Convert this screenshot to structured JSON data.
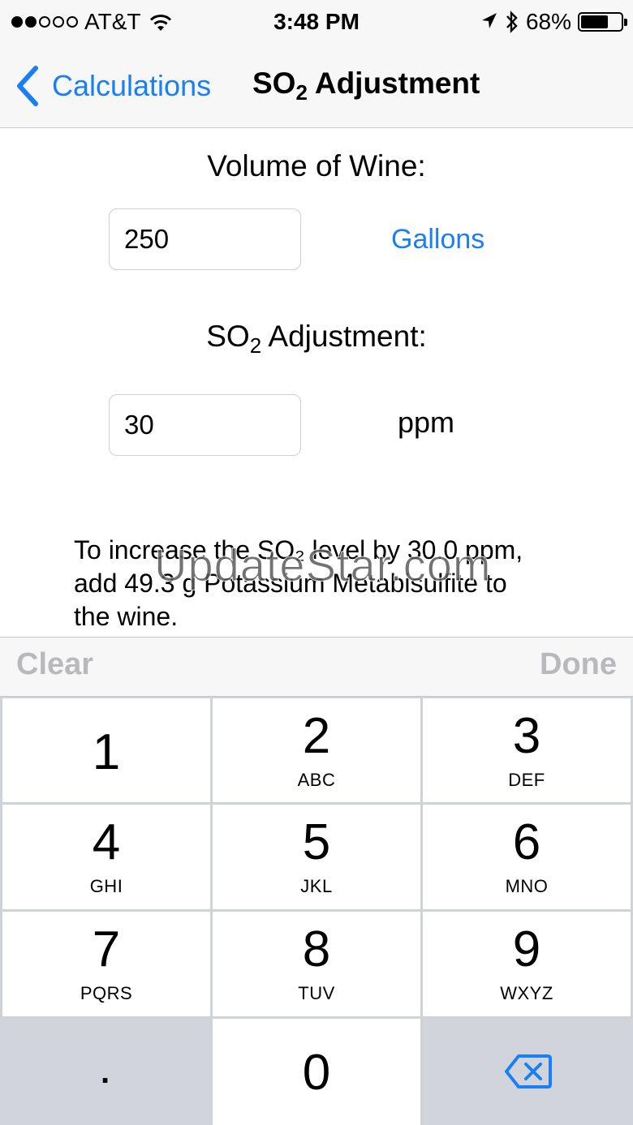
{
  "status_bar": {
    "carrier": "AT&T",
    "signal_bars_filled": 2,
    "signal_bars_total": 5,
    "time": "3:48 PM",
    "battery_percent": "68%",
    "battery_level": 0.68,
    "icons": [
      "wifi-icon",
      "location-icon",
      "bluetooth-icon",
      "battery-icon"
    ]
  },
  "nav": {
    "back_label": "Calculations",
    "title_prefix": "SO",
    "title_subscript": "2",
    "title_suffix": " Adjustment"
  },
  "form": {
    "volume_label": "Volume of Wine:",
    "volume_value": "250",
    "volume_unit": "Gallons",
    "so2_label_prefix": "SO",
    "so2_label_subscript": "2",
    "so2_label_suffix": " Adjustment:",
    "so2_value": "30",
    "so2_unit": "ppm"
  },
  "result_text": "To increase the SO₂ level by 30.0 ppm, add 49.3 g Potassium Metabisulfite to the wine.",
  "watermark": "UpdateStar.com",
  "toolbar": {
    "clear_label": "Clear",
    "done_label": "Done"
  },
  "keypad": {
    "keys": [
      {
        "digit": "1",
        "letters": ""
      },
      {
        "digit": "2",
        "letters": "ABC"
      },
      {
        "digit": "3",
        "letters": "DEF"
      },
      {
        "digit": "4",
        "letters": "GHI"
      },
      {
        "digit": "5",
        "letters": "JKL"
      },
      {
        "digit": "6",
        "letters": "MNO"
      },
      {
        "digit": "7",
        "letters": "PQRS"
      },
      {
        "digit": "8",
        "letters": "TUV"
      },
      {
        "digit": "9",
        "letters": "WXYZ"
      }
    ],
    "decimal": ".",
    "zero": "0",
    "delete_icon": "delete-icon"
  },
  "colors": {
    "accent": "#1a7ff5",
    "disabled": "#b9b9bd",
    "bar_bg": "#f7f7f7",
    "key_dark": "#d1d5db"
  }
}
